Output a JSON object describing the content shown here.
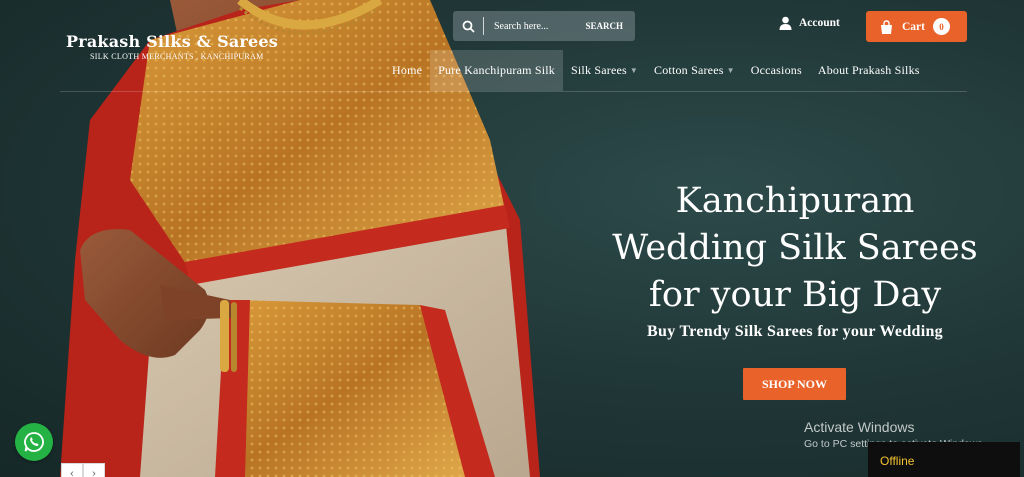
{
  "brand": {
    "name": "Prakash Silks & Sarees",
    "tagline": "SILK CLOTH MERCHANTS , KANCHIPURAM"
  },
  "search": {
    "placeholder": "Search here...",
    "button_label": "SEARCH"
  },
  "account": {
    "label": "Account"
  },
  "cart": {
    "label": "Cart",
    "count": "0"
  },
  "nav": {
    "items": [
      {
        "label": "Home"
      },
      {
        "label": "Pure Kanchipuram Silk",
        "active": true
      },
      {
        "label": "Silk Sarees",
        "dropdown": true
      },
      {
        "label": "Cotton Sarees",
        "dropdown": true
      },
      {
        "label": "Occasions"
      },
      {
        "label": "About Prakash Silks"
      }
    ]
  },
  "hero": {
    "headline_line1": "Kanchipuram",
    "headline_line2": "Wedding Silk Sarees",
    "headline_line3": "for your Big Day",
    "subheading": "Buy Trendy Silk Sarees for your Wedding",
    "cta_label": "SHOP NOW"
  },
  "watermark": {
    "title": "Activate Windows",
    "subtitle": "Go to PC settings to activate Windows."
  },
  "status": {
    "offline_label": "Offline"
  },
  "colors": {
    "accent": "#e8622a",
    "background": "#213838",
    "whatsapp": "#25b245",
    "saree_red": "#c0271d",
    "saree_gold": "#c98a2a"
  },
  "icons": [
    "search-icon",
    "user-icon",
    "shopping-bag-icon",
    "chevron-down-icon",
    "whatsapp-icon",
    "chevron-left-icon",
    "chevron-right-icon"
  ]
}
